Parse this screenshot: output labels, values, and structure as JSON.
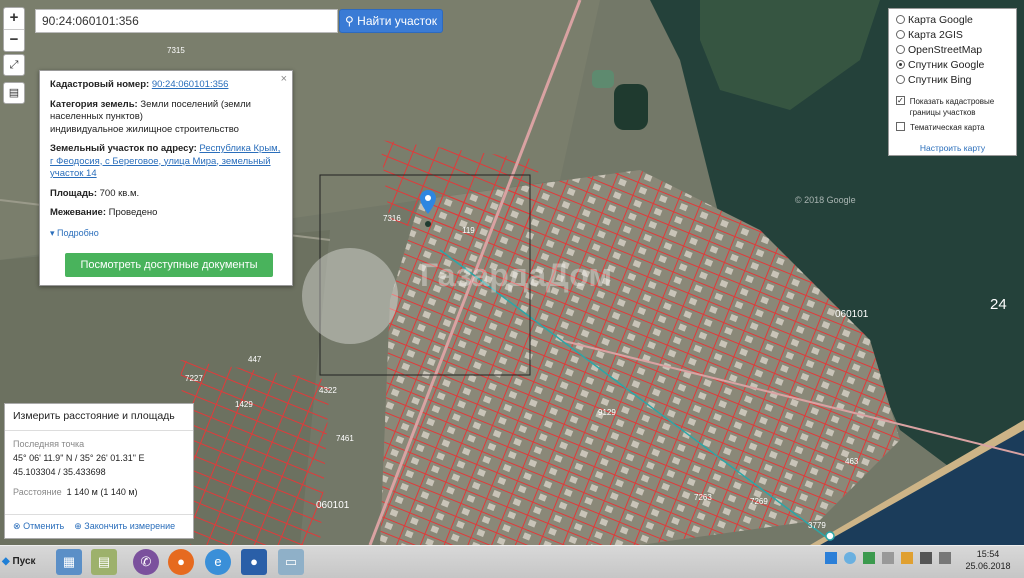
{
  "search": {
    "value": "90:24:060101:356",
    "button_label": "Найти участок",
    "search_icon": "search-icon"
  },
  "zoom": {
    "in": "+",
    "out": "−"
  },
  "info_panel": {
    "cadastral_label": "Кадастровый номер:",
    "cadastral_value": "90:24:060101:356",
    "category_label": "Категория земель:",
    "category_value": "Земли поселений (земли населенных пунктов)",
    "category_use": "индивидуальное жилищное строительство",
    "address_label": "Земельный участок по адресу:",
    "address_value": "Республика Крым, г Феодосия, с Береговое, улица Мира, земельный участок 14",
    "area_label": "Площадь:",
    "area_value": "700 кв.м.",
    "survey_label": "Межевание:",
    "survey_value": "Проведено",
    "more_label": "Подробно",
    "docs_button": "Посмотреть доступные документы",
    "close": "×"
  },
  "layers": {
    "options": [
      "Карта Google",
      "Карта 2GIS",
      "OpenStreetMap",
      "Спутник Google",
      "Спутник Bing"
    ],
    "selected": "Спутник Google",
    "cb_boundaries": "Показать кадастровые границы участков",
    "cb_thematic": "Тематическая карта",
    "setup_link": "Настроить карту"
  },
  "measure": {
    "title": "Измерить расстояние и площадь",
    "last_point_label": "Последняя точка",
    "coords_dms": "45° 06' 11.9\" N / 35° 26' 01.31\" E",
    "coords_dec": "45.103304 / 35.433698",
    "distance_label": "Расстояние",
    "distance_value": "1 140 м (1 140 м)",
    "cancel": "Отменить",
    "finish": "Закончить измерение"
  },
  "map_labels": {
    "block": "060101",
    "block_bottom": "060101",
    "zone": "24",
    "copyright": "© 2018 Google",
    "parcels": [
      "7315",
      "447",
      "7227",
      "7461",
      "4322",
      "7269",
      "9129",
      "463",
      "3779",
      "7263",
      "119",
      "7316",
      "1429"
    ]
  },
  "taskbar": {
    "start": "Пуск",
    "time": "15:54",
    "date": "25.06.2018"
  },
  "colors": {
    "accent": "#3a7bd5",
    "green": "#49b35c",
    "parcel": "#e03a3a",
    "water": "#24413a"
  }
}
